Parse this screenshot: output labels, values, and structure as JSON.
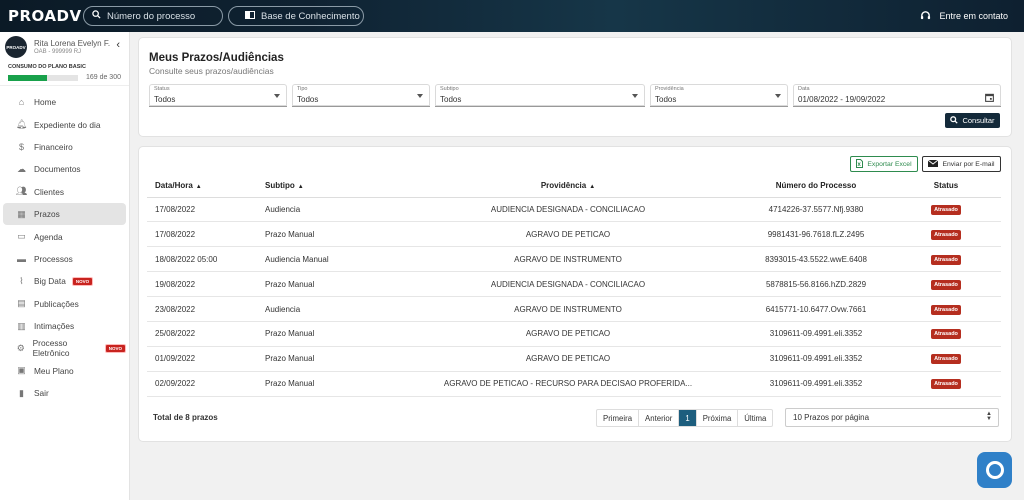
{
  "brand": {
    "name": "PROADV"
  },
  "topbar": {
    "search_placeholder": "Número do processo",
    "knowledge_base": "Base de Conhecimento",
    "contact": "Entre em contato"
  },
  "user": {
    "name": "Rita Lorena Evelyn F.",
    "oab": "OAB - 999999 RJ",
    "avatar_text": "PROADV"
  },
  "plan": {
    "title": "CONSUMO DO PLANO BASIC",
    "used": 169,
    "total": 300,
    "count_text": "169 de 300",
    "color": "#19a14b"
  },
  "nav": [
    {
      "label": "Home",
      "icon": "home-icon",
      "glyph": "⌂"
    },
    {
      "label": "Expediente do dia",
      "icon": "bell-icon",
      "glyph": "🔔︎"
    },
    {
      "label": "Financeiro",
      "icon": "dollar-icon",
      "glyph": "$"
    },
    {
      "label": "Documentos",
      "icon": "cloud-icon",
      "glyph": "☁"
    },
    {
      "label": "Clientes",
      "icon": "users-icon",
      "glyph": "👥︎"
    },
    {
      "label": "Prazos",
      "icon": "calendar-icon",
      "glyph": "▦",
      "active": true
    },
    {
      "label": "Agenda",
      "icon": "calendar-icon",
      "glyph": "▭"
    },
    {
      "label": "Processos",
      "icon": "folder-icon",
      "glyph": "▬"
    },
    {
      "label": "Big Data",
      "icon": "chart-icon",
      "glyph": "⌇",
      "badge": "NOVO"
    },
    {
      "label": "Publicações",
      "icon": "newspaper-icon",
      "glyph": "▤"
    },
    {
      "label": "Intimações",
      "icon": "clipboard-icon",
      "glyph": "▥"
    },
    {
      "label": "Processo Eletrônico",
      "icon": "gear-icon",
      "glyph": "⚙",
      "badge": "NOVO"
    },
    {
      "label": "Meu Plano",
      "icon": "id-card-icon",
      "glyph": "▣"
    },
    {
      "label": "Sair",
      "icon": "exit-icon",
      "glyph": "▮"
    }
  ],
  "page": {
    "title": "Meus Prazos/Audiências",
    "subtitle": "Consulte seus prazos/audiências"
  },
  "filters": {
    "status": {
      "label": "Status",
      "value": "Todos"
    },
    "tipo": {
      "label": "Tipo",
      "value": "Todos"
    },
    "subtipo": {
      "label": "Subtipo",
      "value": "Todos"
    },
    "providencia": {
      "label": "Providência",
      "value": "Todos"
    },
    "data": {
      "label": "Data",
      "value": "01/08/2022 - 19/09/2022"
    },
    "consultar": "Consultar"
  },
  "actions": {
    "export_excel": "Exportar Excel",
    "send_email": "Enviar por E-mail"
  },
  "table": {
    "headers": {
      "data_hora": "Data/Hora",
      "subtipo": "Subtipo",
      "providencia": "Providência",
      "numero": "Número do Processo",
      "status": "Status"
    },
    "rows": [
      {
        "data": "17/08/2022",
        "subtipo": "Audiencia",
        "providencia": "AUDIENCIA DESIGNADA - CONCILIACAO",
        "numero": "4714226-37.5577.Nfj.9380",
        "status": "Atrasado"
      },
      {
        "data": "17/08/2022",
        "subtipo": "Prazo Manual",
        "providencia": "AGRAVO DE PETICAO",
        "numero": "9981431-96.7618.fLZ.2495",
        "status": "Atrasado"
      },
      {
        "data": "18/08/2022 05:00",
        "subtipo": "Audiencia Manual",
        "providencia": "AGRAVO DE INSTRUMENTO",
        "numero": "8393015-43.5522.wwE.6408",
        "status": "Atrasado"
      },
      {
        "data": "19/08/2022",
        "subtipo": "Prazo Manual",
        "providencia": "AUDIENCIA DESIGNADA - CONCILIACAO",
        "numero": "5878815-56.8166.hZD.2829",
        "status": "Atrasado"
      },
      {
        "data": "23/08/2022",
        "subtipo": "Audiencia",
        "providencia": "AGRAVO DE INSTRUMENTO",
        "numero": "6415771-10.6477.Ovw.7661",
        "status": "Atrasado"
      },
      {
        "data": "25/08/2022",
        "subtipo": "Prazo Manual",
        "providencia": "AGRAVO DE PETICAO",
        "numero": "3109611-09.4991.eli.3352",
        "status": "Atrasado"
      },
      {
        "data": "01/09/2022",
        "subtipo": "Prazo Manual",
        "providencia": "AGRAVO DE PETICAO",
        "numero": "3109611-09.4991.eli.3352",
        "status": "Atrasado"
      },
      {
        "data": "02/09/2022",
        "subtipo": "Prazo Manual",
        "providencia": "AGRAVO DE PETICAO - RECURSO PARA DECISAO PROFERIDA...",
        "numero": "3109611-09.4991.eli.3352",
        "status": "Atrasado"
      }
    ]
  },
  "footer": {
    "total": "Total de 8 prazos",
    "pager": {
      "first": "Primeira",
      "prev": "Anterior",
      "current": "1",
      "next": "Próxima",
      "last": "Última"
    },
    "per_page": "10 Prazos por página"
  },
  "colors": {
    "status_late": "#b52e1f",
    "primary": "#142a3a",
    "pager_active": "#1d5e7e"
  }
}
